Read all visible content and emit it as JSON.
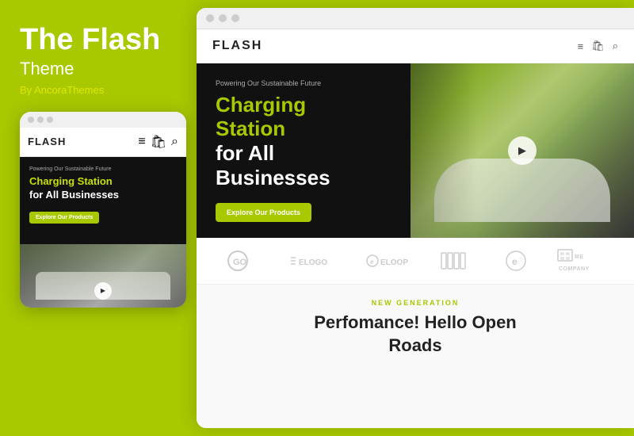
{
  "left": {
    "title": "The Flash",
    "subtitle": "Theme",
    "by": "By AncoraThemes",
    "mobile": {
      "logo": "FLASH",
      "hero_sub": "Powering Our Sustainable Future",
      "hero_title_green": "Charging Station",
      "hero_title_white": "for All Businesses",
      "btn_label": "Explore Our Products",
      "play_icon": "▶"
    }
  },
  "right": {
    "browser_dots": [
      "dot1",
      "dot2",
      "dot3"
    ],
    "nav": {
      "logo": "FLASH",
      "icons": {
        "menu": "≡",
        "bag": "🛍",
        "search": "🔍"
      }
    },
    "hero": {
      "subtitle": "Powering Our Sustainable Future",
      "title_green": "Charging\nStation",
      "title_white": "for All\nBusinesses",
      "btn_label": "Explore Our Products",
      "play_icon": "▶"
    },
    "logos": [
      {
        "id": "go",
        "label": "GO",
        "style": "circle"
      },
      {
        "id": "elogo",
        "label": "ELOGO",
        "style": "text"
      },
      {
        "id": "eloop",
        "label": "ELOOP",
        "style": "text"
      },
      {
        "id": "bars",
        "label": "||||",
        "style": "bars"
      },
      {
        "id": "e2",
        "label": "E",
        "style": "circle"
      },
      {
        "id": "company",
        "label": "COMPANY",
        "style": "text-small"
      }
    ],
    "new_gen": {
      "label": "NEW GENERATION",
      "title_line1": "Perfomance! Hello Open",
      "title_line2": "Roads"
    }
  }
}
